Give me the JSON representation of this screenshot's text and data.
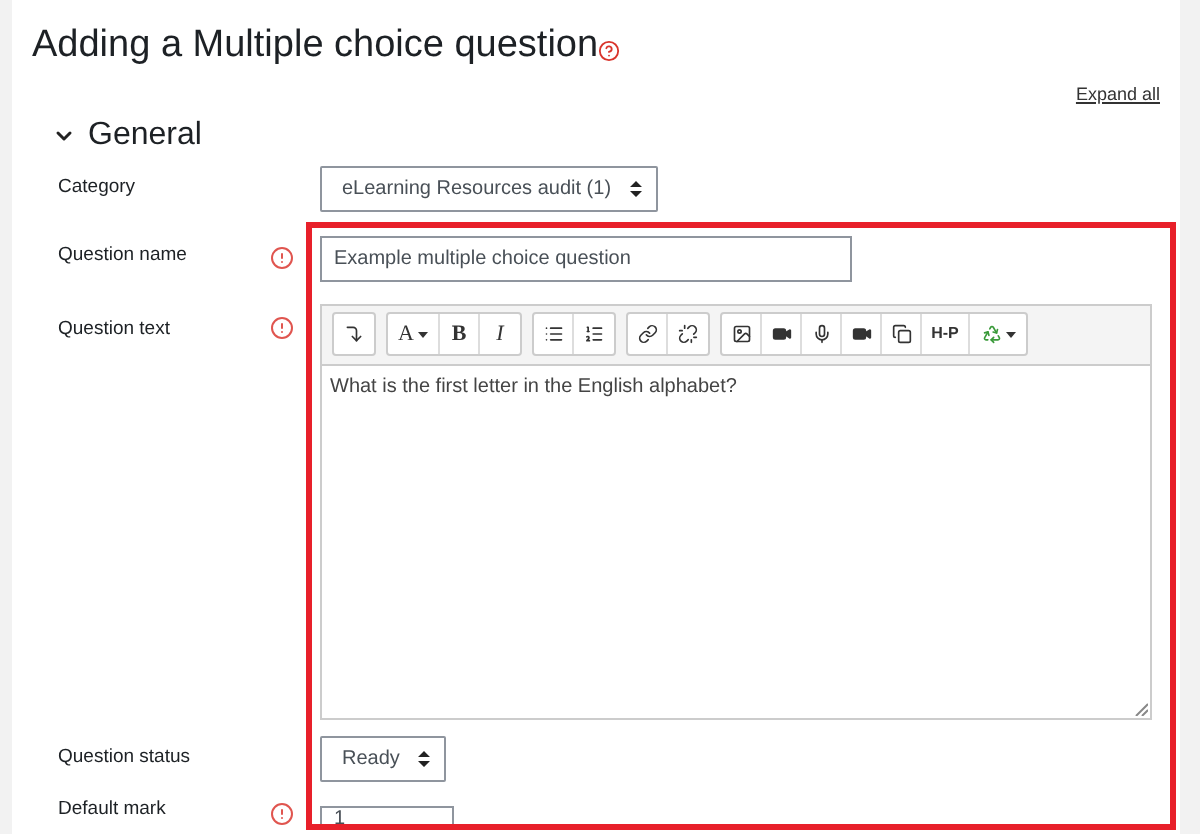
{
  "page_title": "Adding a Multiple choice question",
  "expand_all": "Expand all",
  "section": {
    "title": "General",
    "expanded": true
  },
  "fields": [
    {
      "kind": "select",
      "label": "Category",
      "required": false,
      "value": "eLearning Resources audit (1)"
    },
    {
      "kind": "text",
      "label": "Question name",
      "required": true,
      "value": "Example multiple choice question"
    },
    {
      "kind": "editor",
      "label": "Question text",
      "required": true,
      "value": "What is the first letter in the English alphabet?",
      "toolbar_text": [
        "A",
        "B",
        "I",
        "H-P"
      ]
    },
    {
      "kind": "select",
      "label": "Question status",
      "required": false,
      "value": "Ready"
    },
    {
      "kind": "text",
      "label": "Default mark",
      "required": true,
      "value": "1"
    }
  ],
  "highlight": {
    "shown": true,
    "color": "#e8202a"
  }
}
